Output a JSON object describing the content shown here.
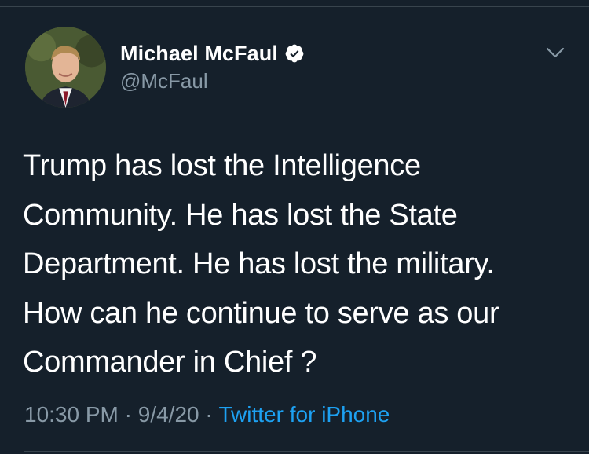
{
  "tweet": {
    "display_name": "Michael McFaul",
    "handle": "@McFaul",
    "verified": true,
    "text": "Trump has lost the Intelligence\nCommunity. He has lost the State\nDepartment. He has  lost the military.\nHow can he continue to serve as our\nCommander in Chief ?",
    "time": "10:30 PM",
    "separator": " · ",
    "date": "9/4/20",
    "source": "Twitter for iPhone"
  },
  "icons": {
    "verified": "verified-badge-icon",
    "more": "chevron-down-icon"
  },
  "colors": {
    "background": "#15202b",
    "primary_text": "#ffffff",
    "secondary_text": "#8899a6",
    "link": "#1da1f2",
    "divider": "#38444d"
  }
}
